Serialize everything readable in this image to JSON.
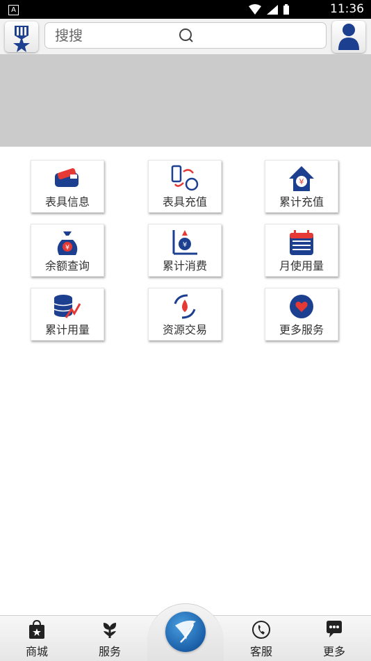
{
  "status_bar": {
    "time": "11:36",
    "app_glyph": "A"
  },
  "header": {
    "search_placeholder": "搜搜"
  },
  "grid": {
    "tiles": [
      {
        "label": "表具信息",
        "icon": "meter-card-icon"
      },
      {
        "label": "表具充值",
        "icon": "phone-recharge-icon"
      },
      {
        "label": "累计充值",
        "icon": "yen-house-icon"
      },
      {
        "label": "余额查询",
        "icon": "money-bag-icon"
      },
      {
        "label": "累计消费",
        "icon": "consumption-chart-icon"
      },
      {
        "label": "月使用量",
        "icon": "calendar-icon"
      },
      {
        "label": "累计用量",
        "icon": "database-trend-icon"
      },
      {
        "label": "资源交易",
        "icon": "water-exchange-icon"
      },
      {
        "label": "更多服务",
        "icon": "heart-icon"
      }
    ]
  },
  "bottom_nav": {
    "items": [
      {
        "label": "商城",
        "icon": "shopping-bag-icon"
      },
      {
        "label": "服务",
        "icon": "flower-icon"
      },
      {
        "label": "客服",
        "icon": "phone-icon"
      },
      {
        "label": "更多",
        "icon": "chat-icon"
      }
    ]
  },
  "colors": {
    "brand_blue": "#1d3f8f",
    "accent_red": "#e53935",
    "banner_gray": "#cbcbcb"
  }
}
